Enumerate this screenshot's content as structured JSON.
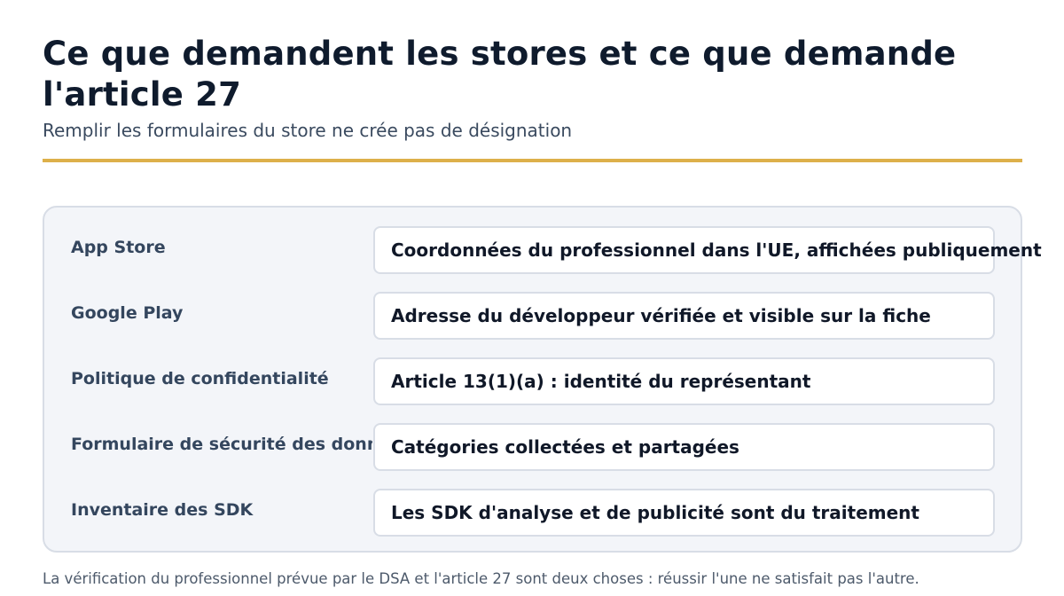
{
  "header": {
    "title": "Ce que demandent les stores et ce que demande l'article 27",
    "subtitle": "Remplir les formulaires du store ne crée pas de désignation"
  },
  "rows": [
    {
      "label": "App Store",
      "value": "Coordonnées du professionnel dans l'UE, affichées publiquement"
    },
    {
      "label": "Google Play",
      "value": "Adresse du développeur vérifiée et visible sur la fiche"
    },
    {
      "label": "Politique de confidentialité",
      "value": "Article 13(1)(a) : identité du représentant"
    },
    {
      "label": "Formulaire de sécurité des données",
      "value": "Catégories collectées et partagées"
    },
    {
      "label": "Inventaire des SDK",
      "value": "Les SDK d'analyse et de publicité sont du traitement"
    }
  ],
  "footnote": "La vérification du professionnel prévue par le DSA et l'article 27 sont deux choses : réussir l'une ne satisfait pas l'autre.",
  "colors": {
    "accent_rule": "#ddb04a",
    "title": "#0f1b2d",
    "panel_bg": "#f3f5f9"
  }
}
